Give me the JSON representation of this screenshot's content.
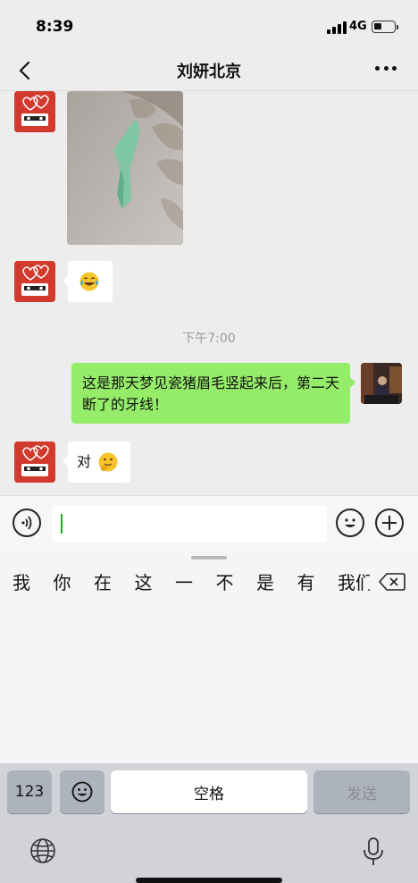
{
  "status_bar": {
    "time": "8:39",
    "network": "4G",
    "battery_level": 0.35
  },
  "nav": {
    "title": "刘妍北京"
  },
  "chat": {
    "timestamp": "下午7:00",
    "messages": [
      {
        "from": "contact",
        "type": "image",
        "icon": "photo-floss-pick"
      },
      {
        "from": "contact",
        "type": "emoji",
        "icon": "laughing-crying-emoji"
      },
      {
        "from": "me",
        "type": "text",
        "text": "这是那天梦见瓷猪眉毛竖起来后，第二天断了的牙线！"
      },
      {
        "from": "contact",
        "type": "text",
        "text": "对",
        "icon": "thinking-emoji"
      }
    ]
  },
  "input": {
    "value": ""
  },
  "keyboard": {
    "candidates": [
      "我",
      "你",
      "在",
      "这",
      "一",
      "不",
      "是",
      "有",
      "我们"
    ],
    "num_key": "123",
    "space_key": "空格",
    "send_key": "发送"
  },
  "colors": {
    "self_bubble": "#95ec69",
    "avatar": "#d23a2e",
    "caret": "#1aad19"
  }
}
